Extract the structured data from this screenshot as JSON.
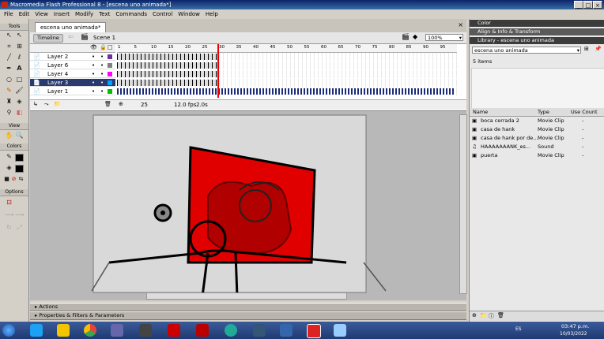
{
  "window": {
    "title": "Macromedia Flash Professional 8 - [escena uno animada*]",
    "min": "_",
    "max": "□",
    "close": "×"
  },
  "menu": [
    "File",
    "Edit",
    "View",
    "Insert",
    "Modify",
    "Text",
    "Commands",
    "Control",
    "Window",
    "Help"
  ],
  "tools": {
    "header": "Tools",
    "view_label": "View",
    "colors_label": "Colors",
    "options_label": "Options"
  },
  "document": {
    "tab": "escena uno animada*",
    "timeline_btn": "Timeline",
    "scene": "Scene 1",
    "zoom": "100%"
  },
  "timeline": {
    "layers": [
      {
        "name": "Layer 2",
        "color": "#7030a0",
        "selected": false
      },
      {
        "name": "Layer 6",
        "color": "#808080",
        "selected": false
      },
      {
        "name": "Layer 4",
        "color": "#ff00ff",
        "selected": false
      },
      {
        "name": "Layer 3",
        "color": "#00a0ff",
        "selected": true
      },
      {
        "name": "Layer 1",
        "color": "#00c000",
        "selected": false
      }
    ],
    "ruler": [
      "1",
      "5",
      "10",
      "15",
      "20",
      "25",
      "30",
      "35",
      "40",
      "45",
      "50",
      "55",
      "60",
      "65",
      "70",
      "75",
      "80",
      "85",
      "90",
      "95"
    ],
    "current_frame": "25",
    "fps": "12.0 fps",
    "time": "2.0s"
  },
  "bottom_panels": {
    "actions": "Actions",
    "properties": "Properties & Filters & Parameters"
  },
  "right_panel": {
    "color": "Color",
    "align": "Align & Info & Transform",
    "library": "Library - escena uno animada",
    "library_doc": "escena uno animada",
    "items_count": "5 items",
    "columns": {
      "name": "Name",
      "type": "Type",
      "use": "Use Count"
    },
    "items": [
      {
        "name": "boca cerrada 2",
        "type": "Movie Clip",
        "use": "-"
      },
      {
        "name": "casa de hank",
        "type": "Movie Clip",
        "use": "-"
      },
      {
        "name": "casa de hank por de...",
        "type": "Movie Clip",
        "use": "-"
      },
      {
        "name": "HAAAAAAANK_es...",
        "type": "Sound",
        "use": "-"
      },
      {
        "name": "puerta",
        "type": "Movie Clip",
        "use": "-"
      }
    ]
  },
  "taskbar": {
    "lang": "ES",
    "time": "03:47 p.m.",
    "date": "10/03/2022"
  }
}
